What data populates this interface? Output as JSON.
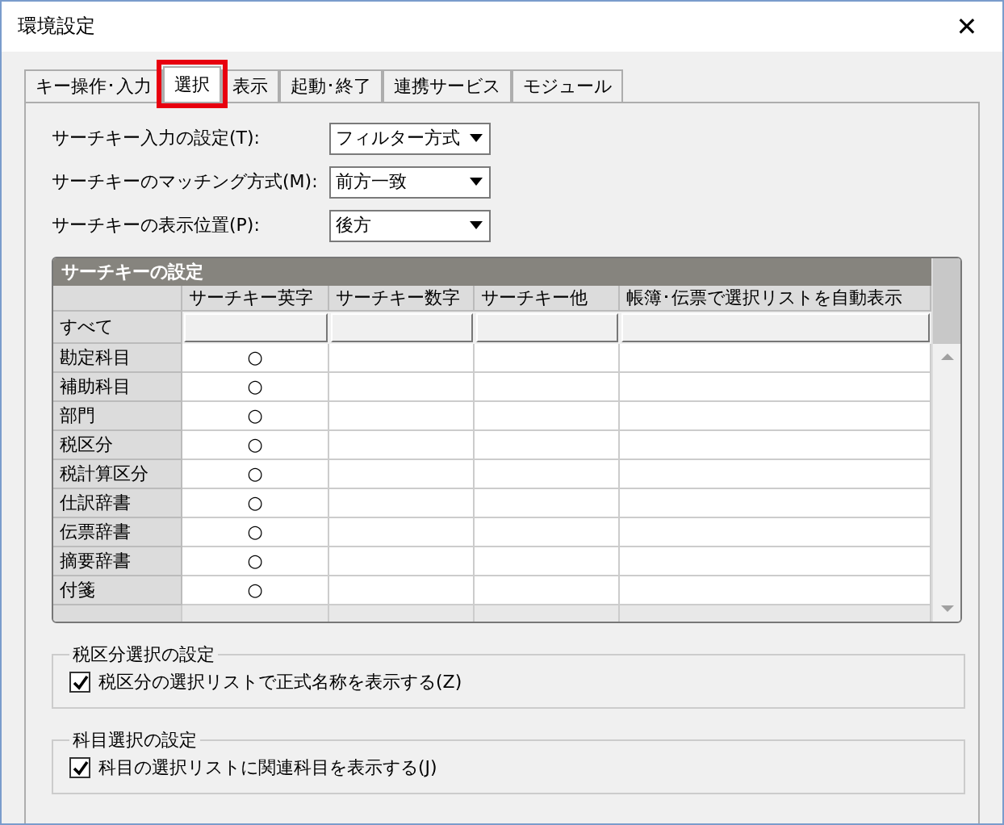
{
  "window": {
    "title": "環境設定",
    "close": "✕"
  },
  "tabs": [
    {
      "label": "キー操作･入力",
      "selected": false,
      "highlighted": false
    },
    {
      "label": "選択",
      "selected": true,
      "highlighted": true
    },
    {
      "label": "表示",
      "selected": false,
      "highlighted": false
    },
    {
      "label": "起動･終了",
      "selected": false,
      "highlighted": false
    },
    {
      "label": "連携サービス",
      "selected": false,
      "highlighted": false
    },
    {
      "label": "モジュール",
      "selected": false,
      "highlighted": false
    }
  ],
  "settings": [
    {
      "label": "サーチキー入力の設定(T):",
      "value": "フィルター方式"
    },
    {
      "label": "サーチキーのマッチング方式(M):",
      "value": "前方一致"
    },
    {
      "label": "サーチキーの表示位置(P):",
      "value": "後方"
    }
  ],
  "grid": {
    "title": "サーチキーの設定",
    "columns": [
      "サーチキー英字",
      "サーチキー数字",
      "サーチキー他",
      "帳簿･伝票で選択リストを自動表示"
    ],
    "all_row": "すべて",
    "rows": [
      {
        "name": "勘定科目",
        "cells": [
          "○",
          "",
          "",
          ""
        ]
      },
      {
        "name": "補助科目",
        "cells": [
          "○",
          "",
          "",
          ""
        ]
      },
      {
        "name": "部門",
        "cells": [
          "○",
          "",
          "",
          ""
        ]
      },
      {
        "name": "税区分",
        "cells": [
          "○",
          "",
          "",
          ""
        ]
      },
      {
        "name": "税計算区分",
        "cells": [
          "○",
          "",
          "",
          ""
        ]
      },
      {
        "name": "仕訳辞書",
        "cells": [
          "○",
          "",
          "",
          ""
        ]
      },
      {
        "name": "伝票辞書",
        "cells": [
          "○",
          "",
          "",
          ""
        ]
      },
      {
        "name": "摘要辞書",
        "cells": [
          "○",
          "",
          "",
          ""
        ]
      },
      {
        "name": "付箋",
        "cells": [
          "○",
          "",
          "",
          ""
        ]
      }
    ]
  },
  "groups": [
    {
      "title": "税区分選択の設定",
      "checkbox": {
        "label": "税区分の選択リストで正式名称を表示する(Z)",
        "checked": true
      }
    },
    {
      "title": "科目選択の設定",
      "checkbox": {
        "label": "科目の選択リストに関連科目を表示する(J)",
        "checked": true
      }
    }
  ]
}
